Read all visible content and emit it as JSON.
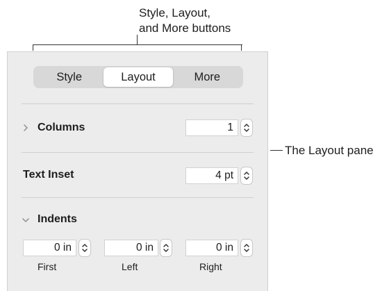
{
  "callouts": {
    "top_line1": "Style, Layout,",
    "top_line2": "and More buttons",
    "right": "The Layout pane"
  },
  "tabs": [
    {
      "label": "Style",
      "active": false
    },
    {
      "label": "Layout",
      "active": true
    },
    {
      "label": "More",
      "active": false
    }
  ],
  "columns": {
    "label": "Columns",
    "value": "1",
    "expanded": false
  },
  "text_inset": {
    "label": "Text Inset",
    "value": "4 pt"
  },
  "indents": {
    "label": "Indents",
    "expanded": true,
    "fields": [
      {
        "label": "First",
        "value": "0 in"
      },
      {
        "label": "Left",
        "value": "0 in"
      },
      {
        "label": "Right",
        "value": "0 in"
      }
    ]
  },
  "icons": {
    "collapsed_disclosure": "chevron-right-icon",
    "expanded_disclosure": "chevron-down-icon",
    "stepper": "stepper-icon"
  },
  "colors": {
    "panel_bg": "#ececec",
    "segment_bg": "#d8d8d8"
  }
}
